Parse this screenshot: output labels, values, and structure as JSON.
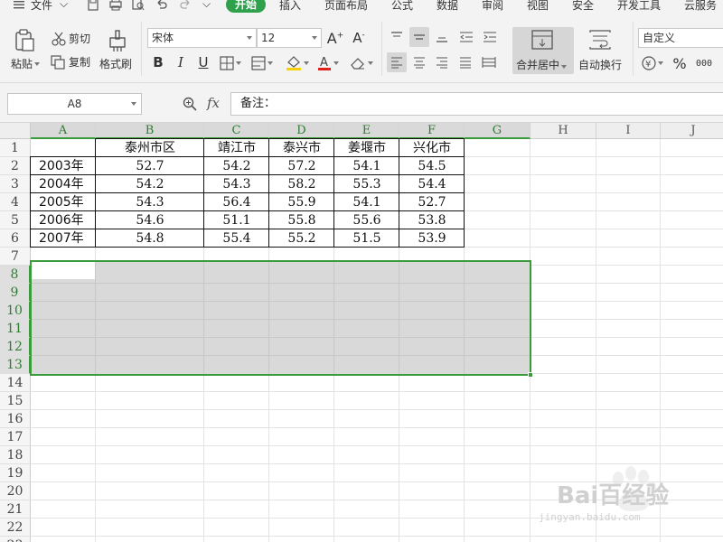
{
  "menubar": {
    "file_label": "文件",
    "tabs": [
      "开始",
      "插入",
      "页面布局",
      "公式",
      "数据",
      "审阅",
      "视图",
      "安全",
      "开发工具",
      "云服务"
    ],
    "active_tab": "开始"
  },
  "ribbon": {
    "paste": "粘贴",
    "cut": "剪切",
    "copy": "复制",
    "format_painter": "格式刷",
    "font_name": "宋体",
    "font_size": "12",
    "bold": "B",
    "italic": "I",
    "underline": "U",
    "merge_center": "合并居中",
    "wrap_text": "自动换行",
    "number_format": "自定义",
    "percent": "%",
    "thousands": "000"
  },
  "formula_bar": {
    "name_box": "A8",
    "fx": "fx",
    "content": "备注："
  },
  "sheet": {
    "columns": [
      "A",
      "B",
      "C",
      "D",
      "E",
      "F",
      "G",
      "H",
      "I",
      "J"
    ],
    "rows": [
      "1",
      "2",
      "3",
      "4",
      "5",
      "6",
      "7",
      "8",
      "9",
      "10",
      "11",
      "12",
      "13",
      "14",
      "15",
      "16",
      "17",
      "18",
      "19",
      "20",
      "21",
      "22",
      "23"
    ],
    "table": {
      "headers": [
        "",
        "泰州市区",
        "靖江市",
        "泰兴市",
        "姜堰市",
        "兴化市"
      ],
      "rows": [
        [
          "2003年",
          "52.7",
          "54.2",
          "57.2",
          "54.1",
          "54.5"
        ],
        [
          "2004年",
          "54.2",
          "54.3",
          "58.2",
          "55.3",
          "54.4"
        ],
        [
          "2005年",
          "54.3",
          "56.4",
          "55.9",
          "54.1",
          "52.7"
        ],
        [
          "2006年",
          "54.6",
          "51.1",
          "55.8",
          "55.6",
          "53.8"
        ],
        [
          "2007年",
          "54.8",
          "55.4",
          "55.2",
          "51.5",
          "53.9"
        ]
      ]
    },
    "selection": "A8:G13",
    "active_cell": "A8"
  },
  "watermark": {
    "text": "Bai百经验",
    "url": "jingyan.baidu.com"
  },
  "colors": {
    "accent_green": "#3a9b3a",
    "active_tab_green": "#2fa14d",
    "selection_fill": "#d9d9d9"
  }
}
